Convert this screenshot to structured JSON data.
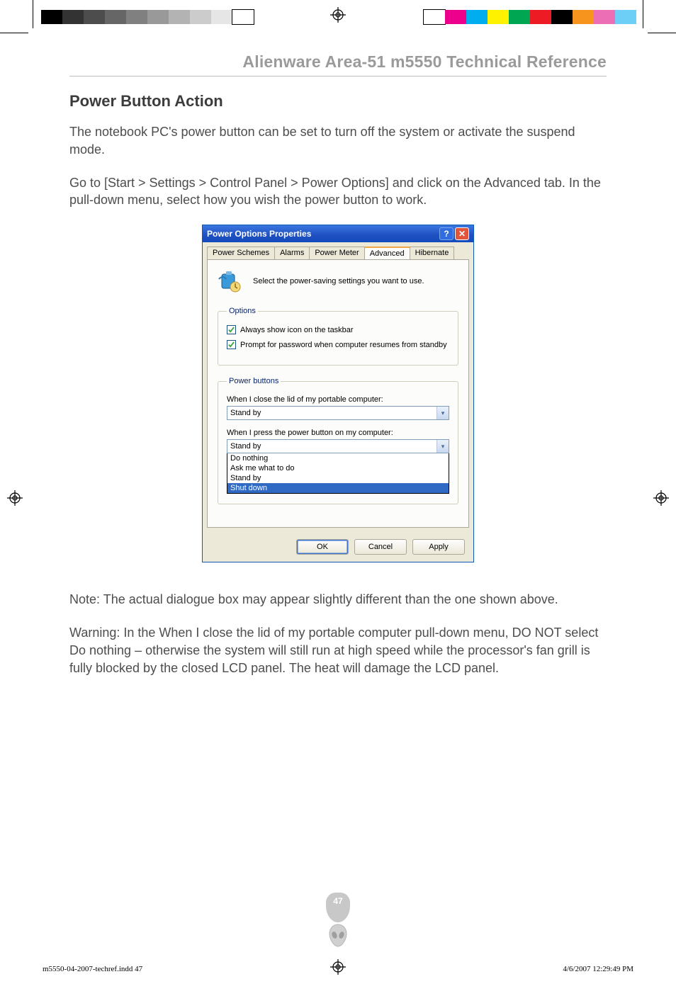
{
  "print_bars": {
    "left": [
      "#000000",
      "#333333",
      "#4d4d4d",
      "#666666",
      "#808080",
      "#999999",
      "#b3b3b3",
      "#cccccc",
      "#e6e6e6",
      "#ffffff"
    ],
    "right": [
      "#ffffff",
      "#ec008c",
      "#00aeef",
      "#fff200",
      "#00a651",
      "#ed1c24",
      "#000000",
      "#f7941d",
      "#ec6eb4",
      "#6dcff6"
    ]
  },
  "doc_header": "Alienware Area-51 m5550 Technical Reference",
  "section_title": "Power Button Action",
  "para1": "The notebook PC's power button can be set to turn off the system or activate the suspend mode.",
  "para2": "Go to [Start > Settings > Control Panel > Power Options] and click on the Advanced tab. In the pull-down menu, select how you wish the power button to work.",
  "dialog": {
    "title": "Power Options Properties",
    "tabs": [
      "Power Schemes",
      "Alarms",
      "Power Meter",
      "Advanced",
      "Hibernate"
    ],
    "active_tab_index": 3,
    "intro": "Select the power-saving settings you want to use.",
    "options_legend": "Options",
    "chk1": "Always show icon on the taskbar",
    "chk2": "Prompt for password when computer resumes from standby",
    "pb_legend": "Power buttons",
    "lid_label": "When I close the lid of my portable computer:",
    "lid_value": "Stand by",
    "btn_label": "When I press the power button on my computer:",
    "btn_value": "Stand by",
    "dd_options": [
      "Do nothing",
      "Ask me what to do",
      "Stand by",
      "Shut down"
    ],
    "dd_selected_index": 3,
    "ok": "OK",
    "cancel": "Cancel",
    "apply": "Apply"
  },
  "note": "Note: The actual dialogue box may appear slightly different than the one shown above.",
  "warning": "Warning: In the When I close the lid of my portable computer pull-down menu, DO NOT select Do nothing – otherwise the system will still run at high speed while the processor's fan grill is fully blocked by the closed LCD panel. The heat will damage the LCD panel.",
  "page_number": "47",
  "imprint": {
    "file": "m5550-04-2007-techref.indd   47",
    "stamp": "4/6/2007   12:29:49 PM"
  }
}
